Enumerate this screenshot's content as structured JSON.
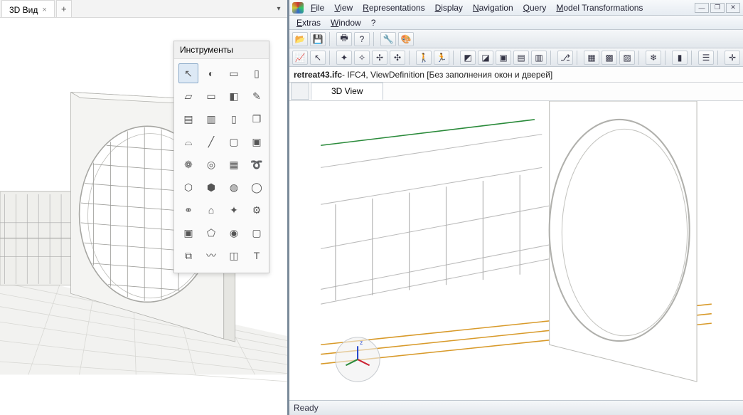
{
  "left_app": {
    "tab_label": "3D Вид",
    "tab_add": "+",
    "palette_title": "Инструменты",
    "tools": [
      "cursor",
      "compass",
      "rect",
      "column",
      "eraser1",
      "eraser2",
      "eraser3",
      "pencil",
      "brick1",
      "brick2",
      "page",
      "pages",
      "arch",
      "line",
      "box1",
      "box2",
      "gears",
      "shape1",
      "grid",
      "spiral",
      "shape2",
      "shape3",
      "cyl",
      "pipe",
      "link",
      "house",
      "wheel",
      "wrench",
      "badge",
      "poly",
      "cam",
      "blank",
      "chain",
      "curve",
      "overlap",
      "text"
    ],
    "tool_glyphs": {
      "cursor": "↖",
      "compass": "◐",
      "rect": "▭",
      "column": "▯",
      "eraser1": "▱",
      "eraser2": "▭",
      "eraser3": "◧",
      "pencil": "✎",
      "brick1": "▤",
      "brick2": "▥",
      "page": "▯",
      "pages": "❐",
      "arch": "⌓",
      "line": "╱",
      "box1": "▢",
      "box2": "▣",
      "gears": "❁",
      "shape1": "◎",
      "grid": "▦",
      "spiral": "➰",
      "shape2": "⬡",
      "shape3": "⬢",
      "cyl": "◍",
      "pipe": "◯",
      "link": "⚭",
      "house": "⌂",
      "wheel": "✦",
      "wrench": "⚙",
      "badge": "▣",
      "poly": "⬠",
      "cam": "◉",
      "blank": "▢",
      "chain": "⧉",
      "curve": "〰",
      "overlap": "◫",
      "text": "T"
    }
  },
  "right_app": {
    "menu1": [
      "File",
      "View",
      "Representations",
      "Display",
      "Navigation",
      "Query",
      "Model Transformations"
    ],
    "menu2": [
      "Extras",
      "Window",
      "?"
    ],
    "toolbar1": [
      "open",
      "save",
      "|",
      "print",
      "?",
      "|",
      "wrench",
      "palette"
    ],
    "toolbar2": [
      "plot",
      "cursor",
      "|",
      "orbit1",
      "orbit2",
      "orbit3",
      "orbit4",
      "|",
      "walk",
      "run",
      "|",
      "cube1",
      "cube2",
      "cube3",
      "cube4",
      "cube5",
      "|",
      "axes",
      "|",
      "grid1",
      "grid2",
      "grid3",
      "|",
      "snow",
      "|",
      "colors",
      "|",
      "layers",
      "|",
      "target"
    ],
    "tb_glyphs": {
      "open": "📂",
      "save": "💾",
      "print": "🖶",
      "?": "?",
      "wrench": "🔧",
      "palette": "🎨",
      "plot": "📈",
      "cursor": "↖",
      "orbit1": "✦",
      "orbit2": "✧",
      "orbit3": "✢",
      "orbit4": "✣",
      "walk": "🚶",
      "run": "🏃",
      "cube1": "◩",
      "cube2": "◪",
      "cube3": "▣",
      "cube4": "▤",
      "cube5": "▥",
      "axes": "⎇",
      "grid1": "▦",
      "grid2": "▩",
      "grid3": "▨",
      "snow": "❄",
      "colors": "▮",
      "layers": "☰",
      "target": "✛"
    },
    "doc_name": "retreat43.ifc",
    "doc_tail": " - IFC4, ViewDefinition [Без заполнения окон и дверей]",
    "view_tab": "3D View",
    "status": "Ready",
    "winbtns": [
      "—",
      "❐",
      "✕"
    ]
  }
}
